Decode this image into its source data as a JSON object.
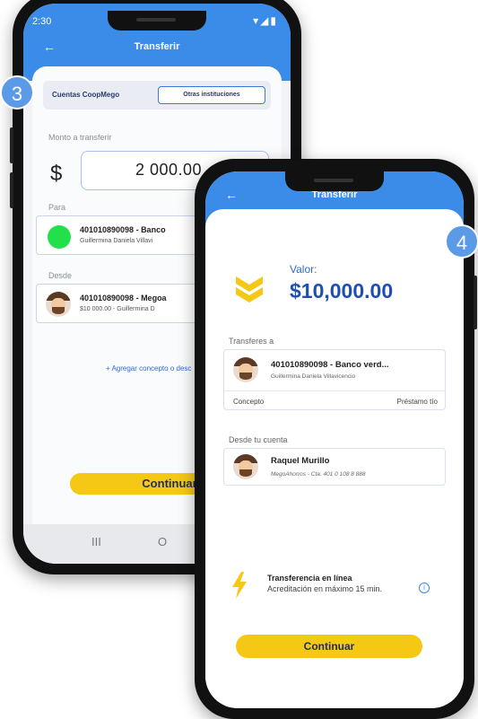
{
  "badges": {
    "step3": "3",
    "step4": "4"
  },
  "phone1": {
    "status": {
      "time": "2:30",
      "icons": "▾◢▮"
    },
    "header": {
      "title": "Transferir"
    },
    "tabs": {
      "left": "Cuentas CoopMego",
      "right": "Otras instituciones"
    },
    "amount": {
      "label": "Monto a transferir",
      "currency": "$",
      "value": "2 000.00"
    },
    "to": {
      "label": "Para",
      "title": "401010890098 - Banco",
      "subtitle": "Guillermina Daniela Villavi"
    },
    "from": {
      "label": "Desde",
      "title": "401010890098 - Megoa",
      "subtitle": "$10 000.00 - Guillermina D"
    },
    "add_concept": "+ Agregar concepto o desc",
    "continue": "Continuar",
    "navbar": {
      "recent": "III",
      "home": "O"
    }
  },
  "phone2": {
    "header": {
      "title": "Transferir"
    },
    "valor": {
      "label": "Valor:",
      "amount": "$10,000.00"
    },
    "transfer_to": {
      "label": "Transferes a",
      "title": "401010890098 - Banco verd...",
      "subtitle": "Guillermina Daniela Villavicencio",
      "concept_label": "Concepto",
      "concept_value": "Préstamo tío"
    },
    "from_account": {
      "label": "Desde tu cuenta",
      "name": "Raquel Murillo",
      "detail": "MegoAhorros - Cta. 401 0 108 8 888"
    },
    "online": {
      "title": "Transferencia en línea",
      "detail": "Acreditación en  máximo 15 min."
    },
    "continue": "Continuar"
  },
  "colors": {
    "primary": "#3b8be8",
    "accent": "#f5c816",
    "dark_blue": "#1f4fb0",
    "green": "#22e04a"
  }
}
